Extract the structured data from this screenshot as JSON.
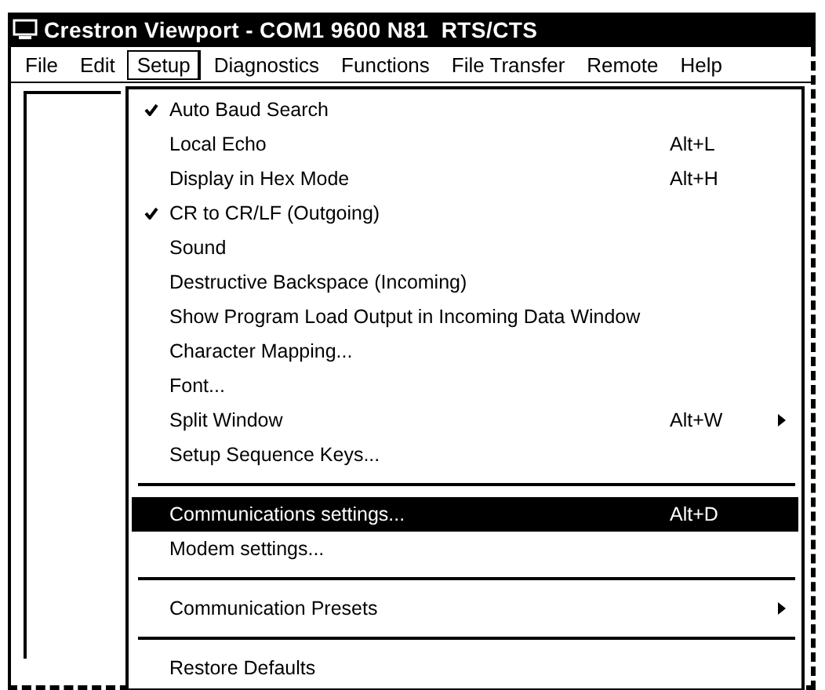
{
  "window": {
    "title": "Crestron Viewport - COM1 9600 N81  RTS/CTS"
  },
  "menu_bar": [
    {
      "label": "File",
      "selected": false
    },
    {
      "label": "Edit",
      "selected": false
    },
    {
      "label": "Setup",
      "selected": true
    },
    {
      "label": "Diagnostics",
      "selected": false
    },
    {
      "label": "Functions",
      "selected": false
    },
    {
      "label": "File Transfer",
      "selected": false
    },
    {
      "label": "Remote",
      "selected": false
    },
    {
      "label": "Help",
      "selected": false
    }
  ],
  "setup_menu": [
    {
      "kind": "item",
      "label": "Auto Baud Search",
      "checked": true,
      "selected": false,
      "submenu": false
    },
    {
      "kind": "item",
      "label": "Local Echo",
      "shortcut": "Alt+L",
      "checked": false,
      "selected": false,
      "submenu": false
    },
    {
      "kind": "item",
      "label": "Display in Hex Mode",
      "shortcut": "Alt+H",
      "checked": false,
      "selected": false,
      "submenu": false
    },
    {
      "kind": "item",
      "label": "CR to CR/LF (Outgoing)",
      "checked": true,
      "selected": false,
      "submenu": false
    },
    {
      "kind": "item",
      "label": "Sound",
      "checked": false,
      "selected": false,
      "submenu": false
    },
    {
      "kind": "item",
      "label": "Destructive Backspace (Incoming)",
      "checked": false,
      "selected": false,
      "submenu": false
    },
    {
      "kind": "item",
      "label": "Show Program Load Output in Incoming Data Window",
      "checked": false,
      "selected": false,
      "submenu": false
    },
    {
      "kind": "item",
      "label": "Character Mapping...",
      "checked": false,
      "selected": false,
      "submenu": false
    },
    {
      "kind": "item",
      "label": "Font...",
      "checked": false,
      "selected": false,
      "submenu": false
    },
    {
      "kind": "item",
      "label": "Split Window",
      "shortcut": "Alt+W",
      "checked": false,
      "selected": false,
      "submenu": true
    },
    {
      "kind": "item",
      "label": "Setup Sequence Keys...",
      "checked": false,
      "selected": false,
      "submenu": false
    },
    {
      "kind": "separator"
    },
    {
      "kind": "item",
      "label": "Communications settings...",
      "shortcut": "Alt+D",
      "checked": false,
      "selected": true,
      "submenu": false
    },
    {
      "kind": "item",
      "label": "Modem settings...",
      "checked": false,
      "selected": false,
      "submenu": false
    },
    {
      "kind": "separator"
    },
    {
      "kind": "item",
      "label": "Communication Presets",
      "checked": false,
      "selected": false,
      "submenu": true
    },
    {
      "kind": "separator"
    },
    {
      "kind": "item",
      "label": "Restore Defaults",
      "checked": false,
      "selected": false,
      "submenu": false
    }
  ]
}
